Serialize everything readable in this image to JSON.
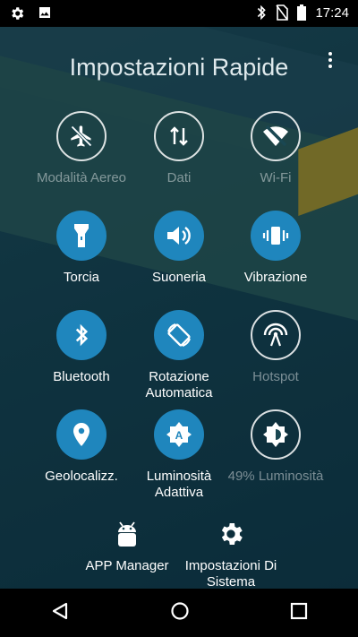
{
  "status_bar": {
    "time": "17:24"
  },
  "title": "Impostazioni Rapide",
  "tiles": [
    {
      "label": "Modalità Aereo",
      "state": "off"
    },
    {
      "label": "Dati",
      "state": "off"
    },
    {
      "label": "Wi-Fi",
      "state": "off"
    },
    {
      "label": "Torcia",
      "state": "on"
    },
    {
      "label": "Suoneria",
      "state": "on"
    },
    {
      "label": "Vibrazione",
      "state": "on"
    },
    {
      "label": "Bluetooth",
      "state": "on"
    },
    {
      "label": "Rotazione Automatica",
      "state": "on"
    },
    {
      "label": "Hotspot",
      "state": "off"
    },
    {
      "label": "Geolocalizz.",
      "state": "on"
    },
    {
      "label": "Luminosità Adattiva",
      "state": "on"
    },
    {
      "label": "49% Luminosità",
      "state": "off"
    }
  ],
  "bottom": {
    "app_manager": "APP Manager",
    "settings": "Impostazioni Di Sistema"
  },
  "colors": {
    "accent": "#1f86bd",
    "statusbar": "#000000"
  }
}
